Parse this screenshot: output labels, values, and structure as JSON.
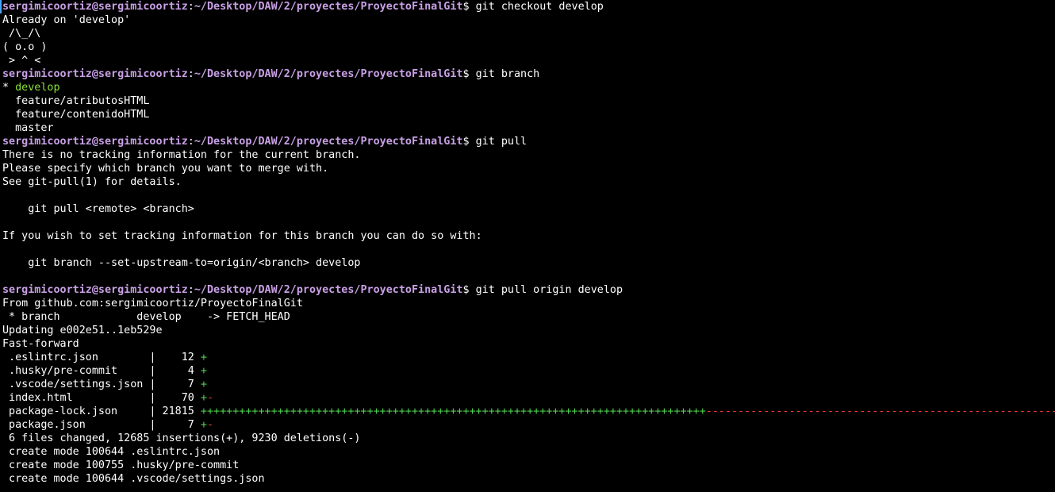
{
  "prompt": {
    "user_host": "sergimicoortiz@sergimicoortiz",
    "sep": ":",
    "path": "~/Desktop/DAW/2/proyectes/ProyectoFinalGit",
    "symbol": "$ "
  },
  "commands": [
    "git checkout develop",
    "git branch",
    "git pull",
    "git pull origin develop"
  ],
  "checkout_output": [
    "Already on 'develop'"
  ],
  "ascii_cat": [
    " /\\_/\\",
    "( o.o )",
    " > ^ <"
  ],
  "branches": {
    "current_marker": "* ",
    "current": "develop",
    "others": [
      "  feature/atributosHTML",
      "  feature/contenidoHTML",
      "  master"
    ]
  },
  "pull_error": [
    "There is no tracking information for the current branch.",
    "Please specify which branch you want to merge with.",
    "See git-pull(1) for details.",
    "",
    "    git pull <remote> <branch>",
    "",
    "If you wish to set tracking information for this branch you can do so with:",
    "",
    "    git branch --set-upstream-to=origin/<branch> develop",
    ""
  ],
  "pull_output": [
    "From github.com:sergimicoortiz/ProyectoFinalGit",
    " * branch            develop    -> FETCH_HEAD",
    "Updating e002e51..1eb529e",
    "Fast-forward"
  ],
  "diffstat": [
    {
      "file": " .eslintrc.json        | ",
      "count": "   12",
      "plus": "+",
      "minus": ""
    },
    {
      "file": " .husky/pre-commit     | ",
      "count": "    4",
      "plus": "+",
      "minus": ""
    },
    {
      "file": " .vscode/settings.json | ",
      "count": "    7",
      "plus": "+",
      "minus": ""
    },
    {
      "file": " index.html            | ",
      "count": "   70",
      "plus": "+",
      "minus": "-"
    },
    {
      "file": " package-lock.json     | ",
      "count": "21815",
      "plus": "+++++++++++++++++++++++++++++++++++++++++++++++++++++++++++++++++++++++++++++++",
      "minus": "----------------------------------------------------------"
    },
    {
      "file": " package.json          | ",
      "count": "    7",
      "plus": "+",
      "minus": "-"
    }
  ],
  "summary": [
    " 6 files changed, 12685 insertions(+), 9230 deletions(-)",
    " create mode 100644 .eslintrc.json",
    " create mode 100755 .husky/pre-commit",
    " create mode 100644 .vscode/settings.json"
  ],
  "colors": {
    "background": "#000000",
    "text": "#ffffff",
    "prompt": "#c9a0e6",
    "current_branch": "#8ae234",
    "insertions": "#4fd04f",
    "deletions": "#ff3a3a"
  }
}
